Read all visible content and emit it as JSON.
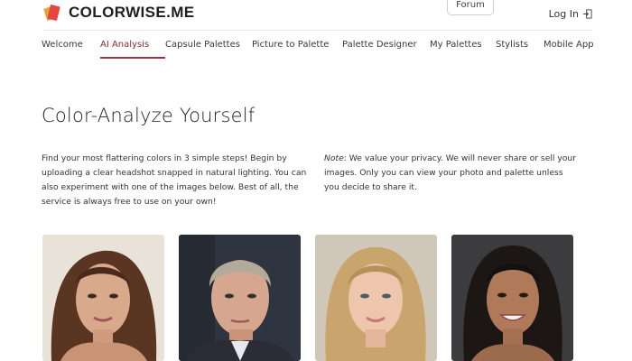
{
  "header": {
    "brand": "COLORWISE.ME",
    "forum_label": "Forum",
    "login_label": "Log In",
    "icons": {
      "logo": "color-swatch-logo",
      "login": "login-icon"
    }
  },
  "nav": {
    "items": [
      {
        "label": "Welcome",
        "active": false
      },
      {
        "label": "AI Analysis",
        "active": true
      },
      {
        "label": "Capsule Palettes",
        "active": false
      },
      {
        "label": "Picture to Palette",
        "active": false
      },
      {
        "label": "Palette Designer",
        "active": false
      },
      {
        "label": "My Palettes",
        "active": false
      },
      {
        "label": "Stylists",
        "active": false
      },
      {
        "label": "Mobile App",
        "active": false
      }
    ]
  },
  "main": {
    "title": "Color-Analyze Yourself",
    "intro": "Find your most flattering colors in 3 simple steps! Begin by uploading a clear headshot snapped in natural lighting. You can also experiment with one of the images below. Best of all, the service is always free to use on your own!",
    "privacy_note_label": "Note",
    "privacy_text": ": We value your privacy. We will never share or sell your images. Only you can view your photo and palette unless you decide to share it."
  },
  "sample_photos": [
    {
      "name": "sample-photo-woman-brunette"
    },
    {
      "name": "sample-photo-man-gray-hair"
    },
    {
      "name": "sample-photo-woman-blonde"
    },
    {
      "name": "sample-photo-woman-dark-hair"
    }
  ],
  "colors": {
    "accent": "#9c3345",
    "logo_red": "#e5463f",
    "logo_orange": "#e9a33a"
  }
}
